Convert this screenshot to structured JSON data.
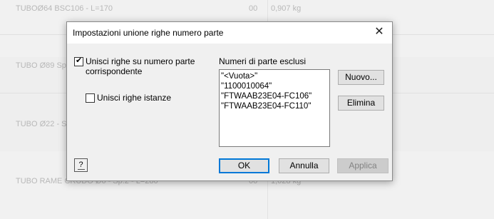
{
  "background": {
    "rows": [
      {
        "description": "TUBOØ64 BSC106 - L=170",
        "qty": "00",
        "weight": "0,907 kg"
      },
      {
        "description": "TUBO Ø89 Sp.",
        "qty": "",
        "weight": ""
      },
      {
        "description": "TUBO Ø22 - Sp",
        "qty": "",
        "weight": ""
      },
      {
        "description": "TUBO RAME CRUDO Ø6 - Sp.2 - L=280",
        "qty": "00",
        "weight": "1,028 kg"
      }
    ]
  },
  "dialog": {
    "title": "Impostazioni unione righe numero parte",
    "close_icon": "close-icon",
    "merge_rows_checkbox": {
      "checked": true,
      "label_line1": "Unisci righe su numero parte",
      "label_line2": "corrispondente"
    },
    "merge_instances_checkbox": {
      "checked": false,
      "label": "Unisci righe istanze"
    },
    "excluded_list": {
      "label": "Numeri di parte esclusi",
      "items": [
        "\"<Vuota>\"",
        "\"1100010064\"",
        "\"FTWAAB23E04-FC106\"",
        "\"FTWAAB23E04-FC110\""
      ]
    },
    "buttons": {
      "new": "Nuovo...",
      "delete": "Elimina",
      "ok": "OK",
      "cancel": "Annulla",
      "apply": "Applica"
    },
    "help_icon": "help-icon"
  }
}
